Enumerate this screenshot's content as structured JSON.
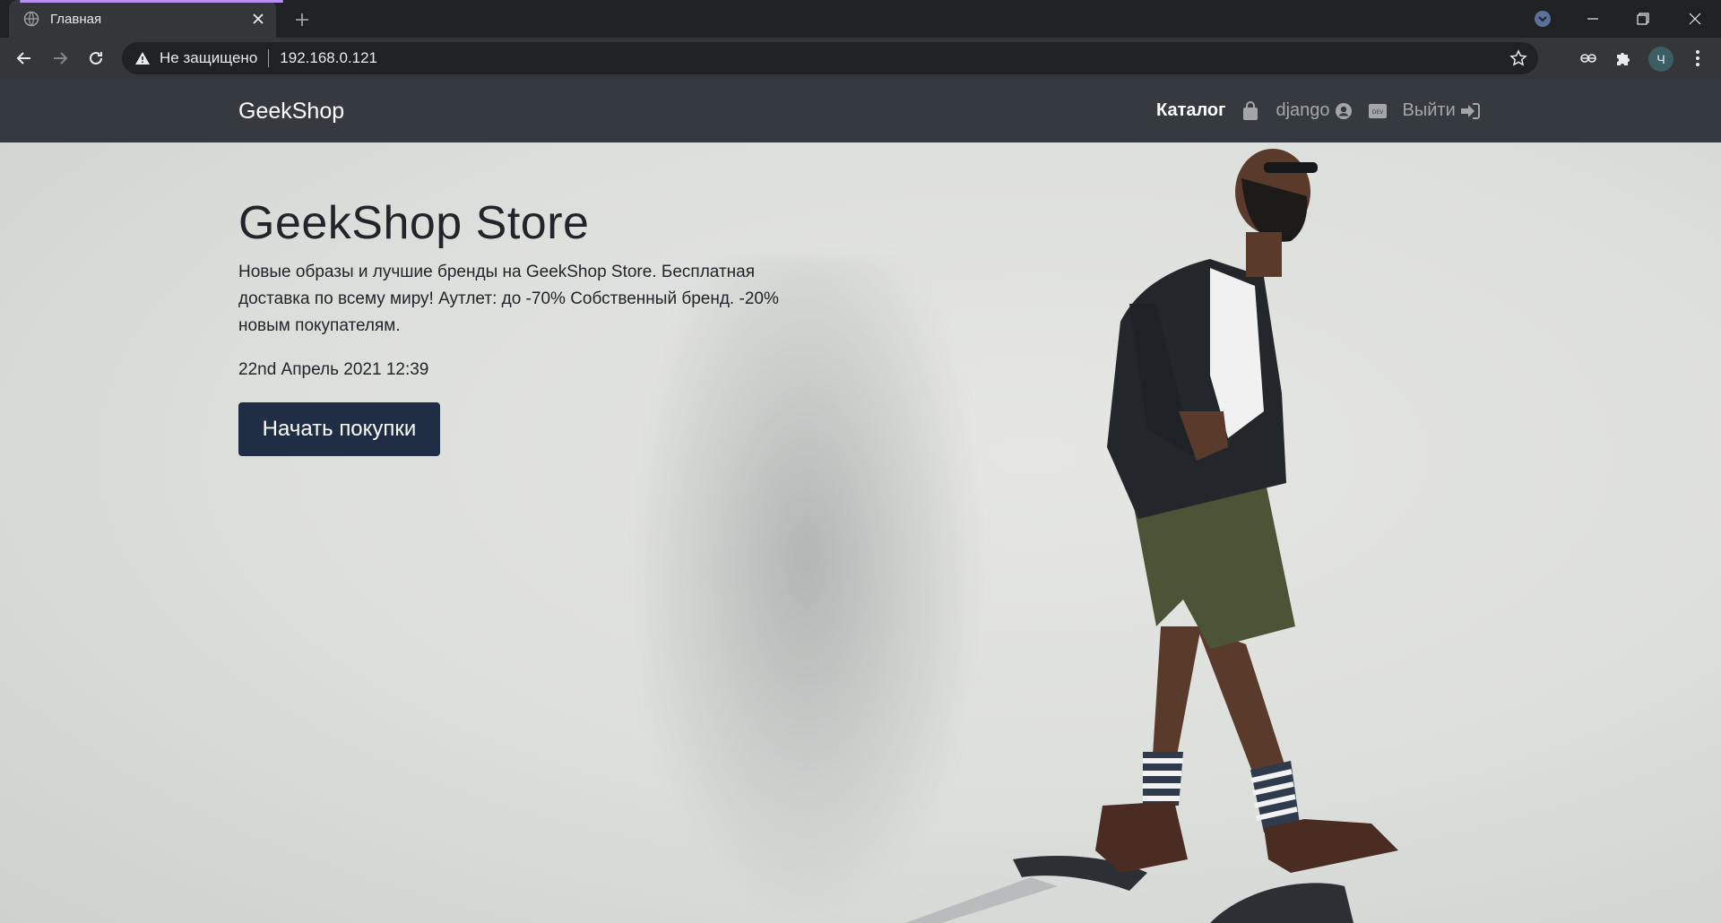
{
  "browser": {
    "tab_title": "Главная",
    "security_label": "Не защищено",
    "url": "192.168.0.121",
    "profile_initial": "Ч"
  },
  "site": {
    "brand": "GeekShop",
    "nav": {
      "catalog": "Каталог",
      "user": "django",
      "logout": "Выйти"
    }
  },
  "hero": {
    "title": "GeekShop Store",
    "text": "Новые образы и лучшие бренды на GeekShop Store. Бесплатная доставка по всему миру! Аутлет: до -70% Собственный бренд. -20% новым покупателям.",
    "date": "22nd Апрель 2021 12:39",
    "cta": "Начать покупки"
  },
  "colors": {
    "navbar_bg": "#343a40",
    "cta_bg": "#1f2d45",
    "hero_bg": "#dcdedb",
    "tab_accent": "#b88ff0"
  }
}
